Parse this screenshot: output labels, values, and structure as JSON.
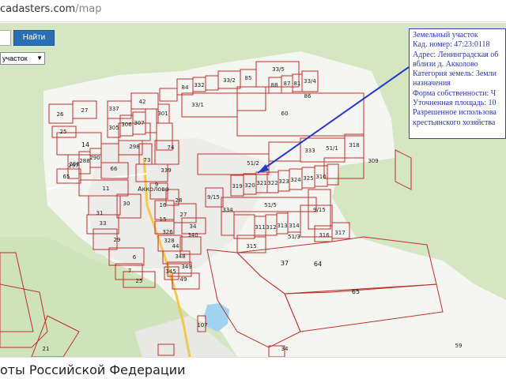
{
  "browser": {
    "url_host": "cadasters.com",
    "url_path": "/map"
  },
  "map_ui": {
    "search_button": "Найти",
    "layer_select": "участок"
  },
  "info_popup": {
    "lines": [
      "Земельный участок",
      "Кад. номер:    47:23:0118",
      "Адрес: Ленинградская об",
      "вблизи д. Акколово",
      "Категория земель: Земли",
      "назначения",
      "Форма собственности: Ч",
      "Уточненная площадь: 10",
      "Разрешенное использова",
      "крестьянского хозяйства"
    ]
  },
  "village_name": "Акколово",
  "parcels": [
    "26",
    "27",
    "25",
    "42",
    "84",
    "332",
    "33/2",
    "85",
    "33/5",
    "337",
    "305",
    "306",
    "307",
    "301",
    "33/1",
    "60",
    "88",
    "81",
    "33/4",
    "87",
    "86",
    "14",
    "297",
    "298",
    "73",
    "290",
    "74",
    "288",
    "66",
    "65",
    "11",
    "286",
    "339",
    "28",
    "9",
    "33",
    "31",
    "30",
    "16",
    "15",
    "27",
    "29",
    "326",
    "328",
    "34",
    "340",
    "348",
    "44",
    "6",
    "7",
    "349",
    "345",
    "25",
    "49",
    "51/2",
    "309",
    "333",
    "51/1",
    "318",
    "319",
    "320",
    "321",
    "322",
    "323",
    "324",
    "325",
    "310",
    "51/5",
    "316",
    "317",
    "314",
    "313",
    "312",
    "311",
    "51/3",
    "315",
    "37",
    "64",
    "65",
    "9/15",
    "334",
    "9/15",
    "107",
    "21",
    "34",
    "59"
  ],
  "footer": {
    "title": "оты Российской Федерации"
  }
}
